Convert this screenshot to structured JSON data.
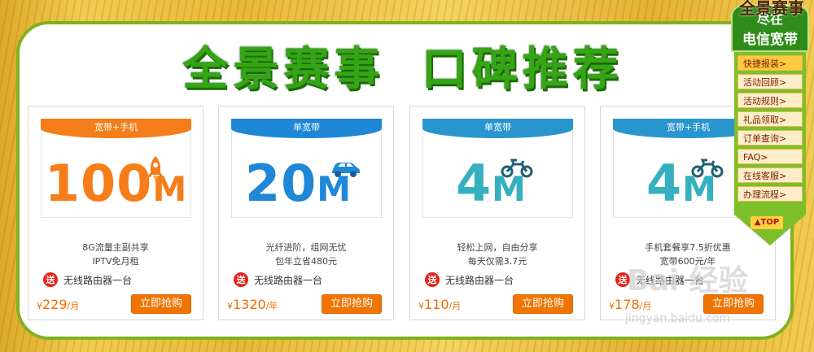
{
  "title": {
    "part1": "全景赛事",
    "part2": "口碑推荐"
  },
  "cards": [
    {
      "ribbon": "宽带+手机",
      "speed": "100",
      "unit": "M",
      "vehicle": "rocket-icon",
      "desc1": "8G流量主副共享",
      "desc2": "IPTV免月租",
      "gift_badge": "送",
      "gift": "无线路由器一台",
      "currency": "¥",
      "price": "229",
      "period": "/月",
      "buy": "立即抢购"
    },
    {
      "ribbon": "单宽带",
      "speed": "20",
      "unit": "M",
      "vehicle": "car-icon",
      "desc1": "光纤进阶，组网无忧",
      "desc2": "包年立省480元",
      "gift_badge": "送",
      "gift": "无线路由器一台",
      "currency": "¥",
      "price": "1320",
      "period": "/年",
      "buy": "立即抢购"
    },
    {
      "ribbon": "单宽带",
      "speed": "4",
      "unit": "M",
      "vehicle": "motorbike-icon",
      "desc1": "轻松上网，自由分享",
      "desc2": "每天仅需3.7元",
      "gift_badge": "送",
      "gift": "无线路由器一台",
      "currency": "¥",
      "price": "110",
      "period": "/月",
      "buy": "立即抢购"
    },
    {
      "ribbon": "宽带+手机",
      "speed": "4",
      "unit": "M",
      "vehicle": "motorbike-icon",
      "desc1": "手机套餐享7.5折优惠",
      "desc2": "宽带600元/年",
      "gift_badge": "送",
      "gift": "无线路由器一台",
      "currency": "¥",
      "price": "178",
      "period": "/月",
      "buy": "立即抢购"
    }
  ],
  "sidenav": {
    "head": "全景赛事",
    "top1": "尽在",
    "top2": "电信宽带",
    "items": [
      "快捷报装>",
      "活动回顾>",
      "活动规则>",
      "礼品领取>",
      "订单查询>",
      "FAQ>",
      "在线客服>",
      "办理流程>"
    ],
    "back_top": "▲TOP"
  },
  "watermark": {
    "text": "Bai 经验",
    "url": "jingyan.baidu.com"
  },
  "colors": {
    "orange": "#f57d1a",
    "blue": "#1e87d6",
    "teal": "#36b0c0",
    "green": "#35a516"
  }
}
